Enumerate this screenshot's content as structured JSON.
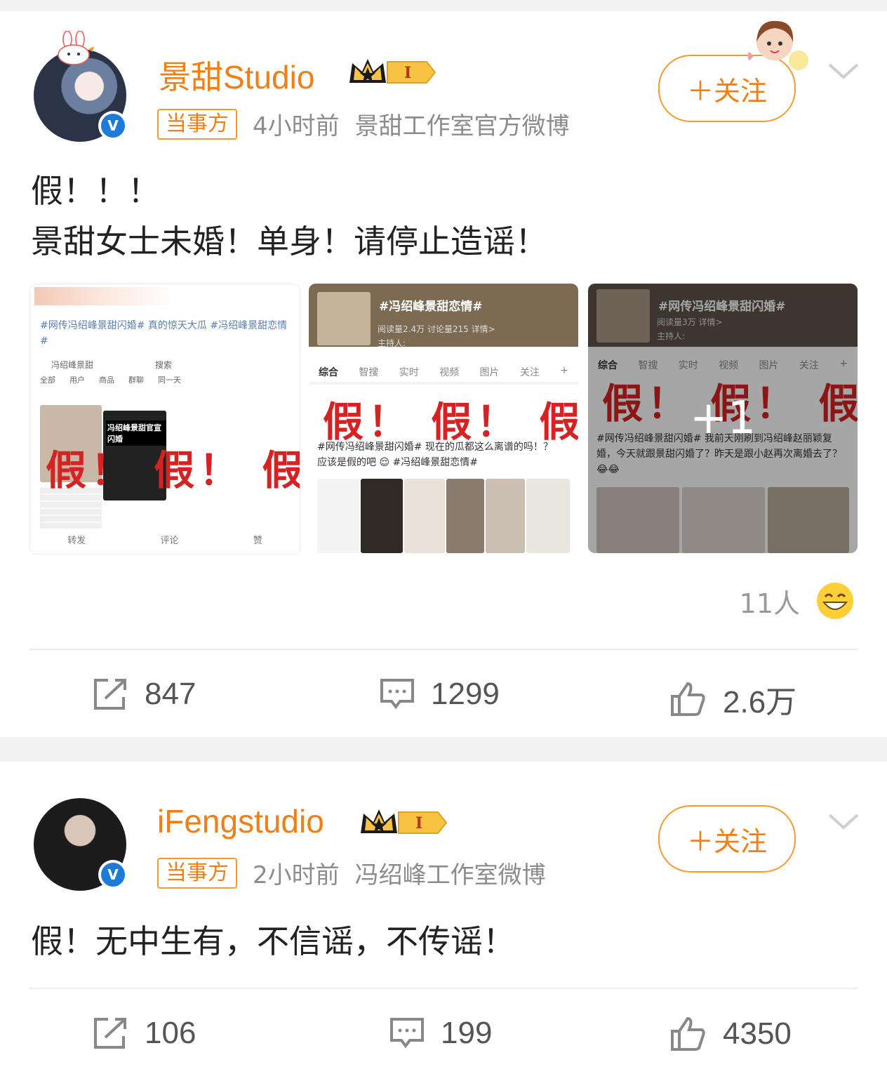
{
  "post1": {
    "username": "景甜Studio",
    "tag": "当事方",
    "time": "4小时前",
    "source": "景甜工作室官方微博",
    "follow_label": "＋关注",
    "content_line1": "假！！！",
    "content_line2": "景甜女士未婚！单身！请停止造谣！",
    "images": [
      {
        "hashtag": "#网传冯绍峰景甜闪婚# 真的惊天大瓜 #冯绍峰景甜恋情#",
        "search_text": "冯绍峰景甜",
        "search_btn": "搜索",
        "tabs": [
          "全部",
          "用户",
          "商品",
          "群聊",
          "同一天"
        ],
        "card_title": "冯绍峰景甜官宣闪婚",
        "fake_text": "假！ 假！ 假！",
        "mini_actions": [
          "转发",
          "评论",
          "赞"
        ]
      },
      {
        "title": "#冯绍峰景甜恋情#",
        "stats": "阅读量2.4万  讨论量215  详情>",
        "host": "主持人:",
        "tabs": [
          "综合",
          "智搜",
          "实时",
          "视频",
          "图片",
          "关注",
          "+"
        ],
        "fake_text": "假！ 假！ 假！",
        "hashtag": "#网传冯绍峰景甜闪婚# 现在的瓜都这么离谱的吗！？应该是假的吧 😌 #冯绍峰景甜恋情#"
      },
      {
        "title": "#网传冯绍峰景甜闪婚#",
        "stats": "阅读量3万  详情>",
        "host": "主持人:",
        "tabs": [
          "综合",
          "智搜",
          "实时",
          "视频",
          "图片",
          "关注",
          "+"
        ],
        "fake_text": "假！ 假！ 假！",
        "hashtag": "#网传冯绍峰景甜闪婚# 我前天刚刷到冯绍峰赵丽颖复婚，今天就跟景甜闪婚了？昨天是跟小赵再次离婚去了？😂😂",
        "more_count": "+1"
      }
    ],
    "likes_people": "11人",
    "repost": "847",
    "comment": "1299",
    "like": "2.6万"
  },
  "post2": {
    "username": "iFengstudio",
    "tag": "当事方",
    "time": "2小时前",
    "source": "冯绍峰工作室微博",
    "follow_label": "＋关注",
    "content": "假！无中生有，不信谣，不传谣！",
    "repost": "106",
    "comment": "199",
    "like": "4350"
  },
  "colors": {
    "accent": "#f07f16",
    "verified": "#1e7ad9",
    "fake_red": "#d62222"
  }
}
